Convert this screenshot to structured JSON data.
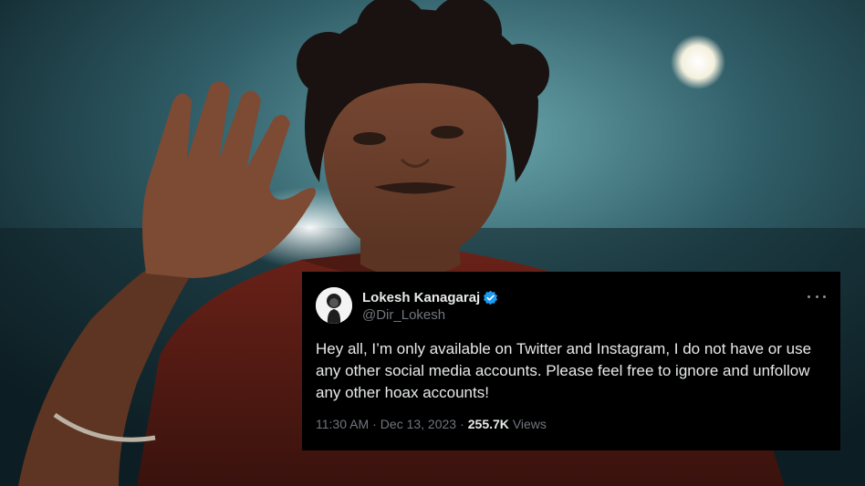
{
  "tweet": {
    "author_name": "Lokesh Kanagaraj",
    "author_handle": "@Dir_Lokesh",
    "text": "Hey all, I’m only available on Twitter and Instagram, I do not have or use any other social media accounts. Please feel free to ignore and unfollow any other hoax accounts!",
    "time": "11:30 AM",
    "date": "Dec 13, 2023",
    "views_count": "255.7K",
    "views_label": "Views",
    "separator": "·"
  },
  "icons": {
    "verified": "verified-badge-icon",
    "more": "more-options-icon"
  },
  "colors": {
    "card_background": "#000000",
    "verified_blue": "#1d9bf0",
    "text_primary": "#e7e9ea",
    "text_secondary": "#71767b"
  }
}
